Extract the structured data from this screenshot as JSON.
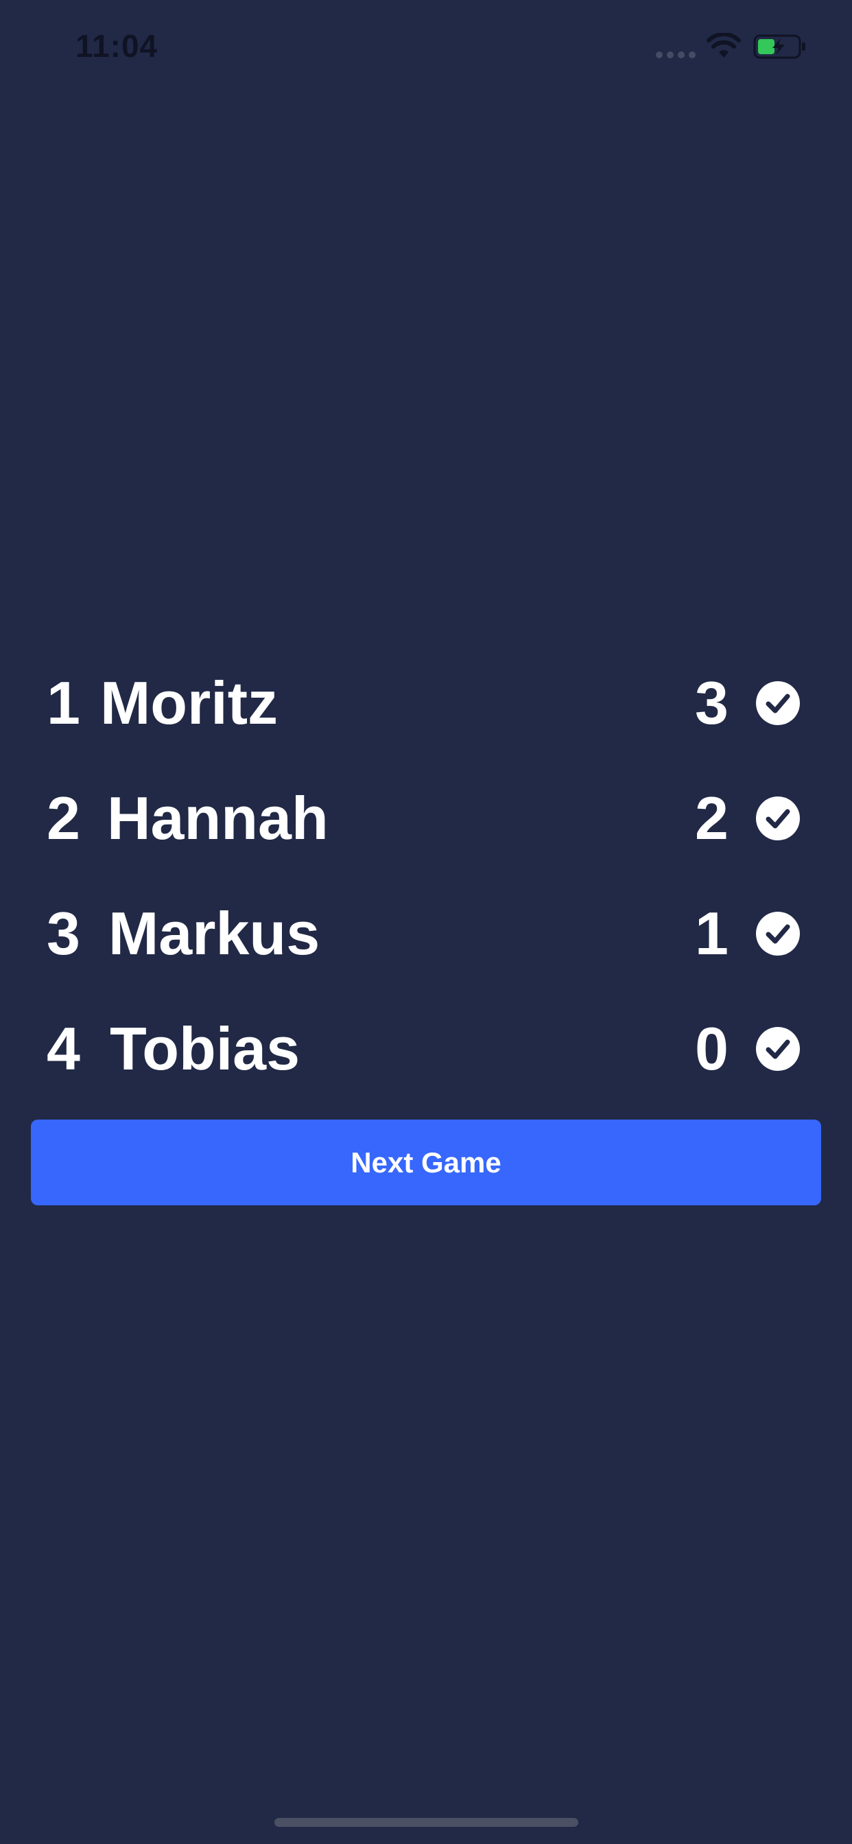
{
  "status_bar": {
    "time": "11:04",
    "icons": [
      "signal-dots-icon",
      "wifi-icon",
      "battery-charging-icon"
    ],
    "battery_color": "#34c759"
  },
  "scoreboard": {
    "rows": [
      {
        "rank": "1",
        "name": "Moritz",
        "points": "3",
        "icon": "check-circle-icon"
      },
      {
        "rank": "2",
        "name": "Hannah",
        "points": "2",
        "icon": "check-circle-icon"
      },
      {
        "rank": "3",
        "name": "Markus",
        "points": "1",
        "icon": "check-circle-icon"
      },
      {
        "rank": "4",
        "name": "Tobias",
        "points": "0",
        "icon": "check-circle-icon"
      }
    ]
  },
  "actions": {
    "next_game_label": "Next Game"
  },
  "colors": {
    "background": "#212946",
    "accent": "#3767fd",
    "text": "#ffffff"
  }
}
